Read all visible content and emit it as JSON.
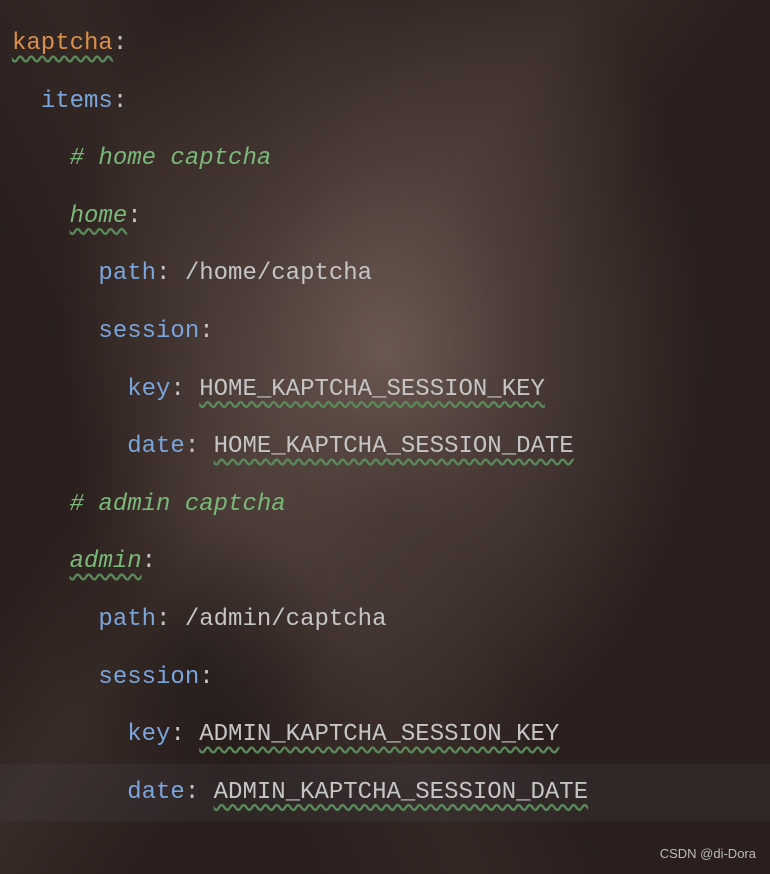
{
  "code": {
    "line1_key": "kaptcha",
    "line2_key": "items",
    "line3_comment": "# home captcha",
    "line4_key": "home",
    "line5_key": "path",
    "line5_value": "/home/captcha",
    "line6_key": "session",
    "line7_key": "key",
    "line7_value": "HOME_KAPTCHA_SESSION_KEY",
    "line8_key": "date",
    "line8_value": "HOME_KAPTCHA_SESSION_DATE",
    "line9_comment": "# admin captcha",
    "line10_key": "admin",
    "line11_key": "path",
    "line11_value": "/admin/captcha",
    "line12_key": "session",
    "line13_key": "key",
    "line13_value": "ADMIN_KAPTCHA_SESSION_KEY",
    "line14_key": "date",
    "line14_value": "ADMIN_KAPTCHA_SESSION_DATE"
  },
  "watermark": "CSDN @di-Dora"
}
